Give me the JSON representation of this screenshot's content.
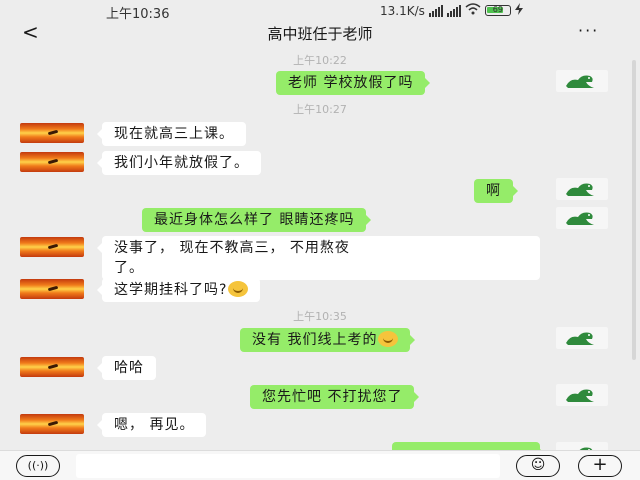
{
  "status_bar": {
    "time": "上午10:36",
    "network_speed": "13.1K/s",
    "battery_level": "69"
  },
  "header": {
    "back_icon": "back-chevron-icon",
    "back_glyph": "<",
    "title": "高中班任于老师",
    "more_glyph": "···",
    "more_icon": "more-dots-icon"
  },
  "messages": {
    "t1": "上午10:22",
    "m1": "老师 学校放假了吗",
    "t2": "上午10:27",
    "m2": "现在就高三上课。",
    "m3": "我们小年就放假了。",
    "m4": "啊",
    "m5": "最近身体怎么样了 眼睛还疼吗",
    "m6a": "没事了， 现在不教高三， 不用熬夜",
    "m6b": "了。",
    "m7": "这学期挂科了吗?",
    "t3": "上午10:35",
    "m8": "没有 我们线上考的",
    "m9": "哈哈",
    "m10": "您先忙吧 不打扰您了",
    "m11": "嗯， 再见。"
  },
  "input_bar": {
    "voice_glyph": "((·))",
    "text_value": "",
    "emoji_glyph": "☺",
    "plus_glyph": "+"
  },
  "colors": {
    "background": "#ededed",
    "self_bubble": "#95ec69",
    "other_bubble": "#ffffff",
    "time_label": "#b2b2b2"
  }
}
